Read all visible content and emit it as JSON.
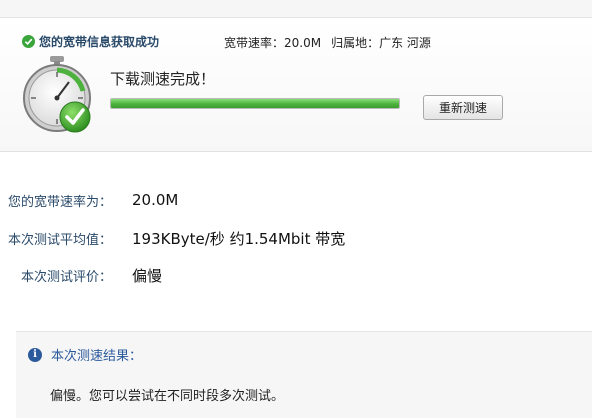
{
  "status": {
    "text": "您的宽带信息获取成功",
    "rate_label": "宽带速率：",
    "rate_value": "20.0M",
    "location_label": "归属地：",
    "location_value": "广东 河源"
  },
  "test": {
    "done_text": "下载测速完成！",
    "progress_percent": 100,
    "retest_label": "重新测速"
  },
  "info": {
    "rate_label": "您的宽带速率为：",
    "rate_value": "20.0M",
    "average_label": "本次测试平均值：",
    "average_value": "193KByte/秒 约1.54Mbit 带宽",
    "rating_label": "本次测试评价：",
    "rating_value": "偏慢"
  },
  "result": {
    "title": "本次测速结果：",
    "detail": "偏慢。您可以尝试在不同时段多次测试。"
  },
  "colors": {
    "accent_green": "#3aa53a",
    "label_blue": "#2a4a6a",
    "info_blue": "#2b5a9c"
  }
}
